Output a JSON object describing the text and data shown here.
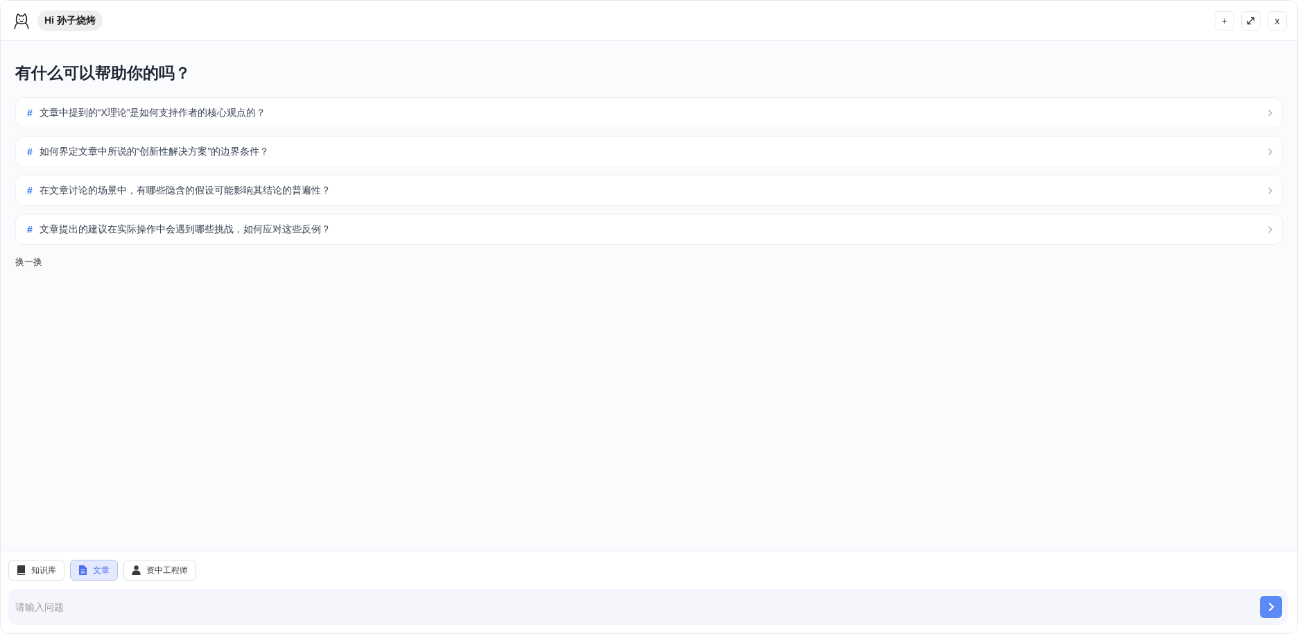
{
  "header": {
    "greeting": "Hi 孙子烧烤",
    "buttons": [
      {
        "kind": "add",
        "label": "+"
      },
      {
        "kind": "expand"
      },
      {
        "kind": "close",
        "label": "x"
      }
    ]
  },
  "main": {
    "title": "有什么可以帮助你的吗？",
    "questions": [
      {
        "marker": "#",
        "text": "文章中提到的“X理论”是如何支持作者的核心观点的？"
      },
      {
        "marker": "#",
        "text": "如何界定文章中所说的“创新性解决方案”的边界条件？"
      },
      {
        "marker": "#",
        "text": "在文章讨论的场景中，有哪些隐含的假设可能影响其结论的普遍性？"
      },
      {
        "marker": "#",
        "text": "文章提出的建议在实际操作中会遇到哪些挑战，如何应对这些反例？"
      }
    ],
    "refresh": "换一换"
  },
  "tools": [
    {
      "kind": "book",
      "label": "知识库",
      "selected": false
    },
    {
      "kind": "document",
      "label": "文章",
      "selected": true
    },
    {
      "kind": "person",
      "label": "资中工程师",
      "selected": false
    }
  ],
  "input": {
    "placeholder": "请输入问题"
  }
}
